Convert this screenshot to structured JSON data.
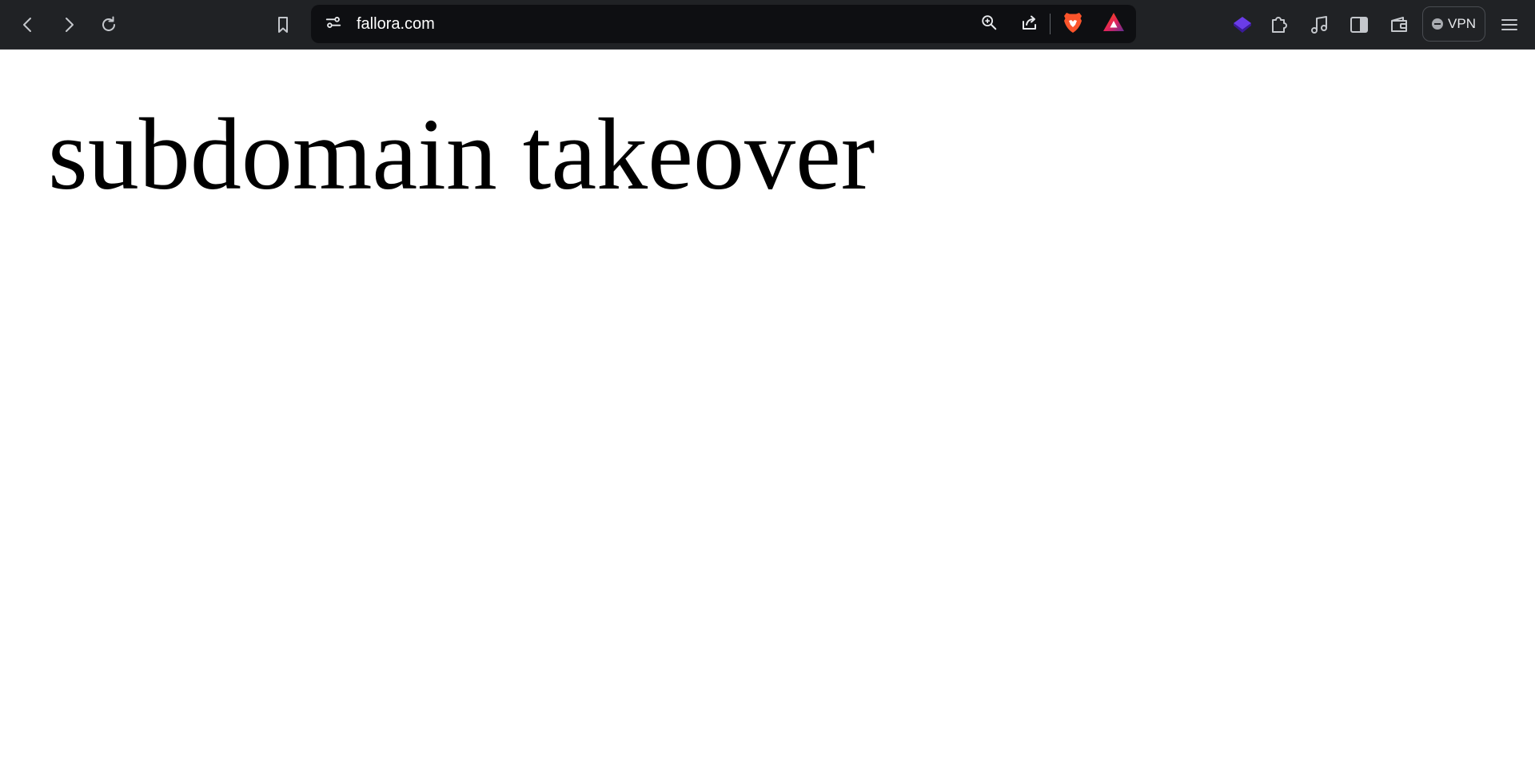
{
  "browser": {
    "url": "fallora.com",
    "nav_icons": [
      "back-icon",
      "forward-icon",
      "reload-icon",
      "bookmark-icon"
    ],
    "url_icons": [
      "site-settings-icon",
      "zoom-icon",
      "share-icon",
      "brave-shields-icon",
      "brave-rewards-icon"
    ],
    "toolbar_icons": [
      "wallet-extension-icon",
      "extensions-icon",
      "media-icon",
      "sidebar-icon",
      "wallet-icon",
      "menu-icon"
    ],
    "vpn_label": "VPN",
    "colors": {
      "toolbar_bg": "#202225",
      "urlbar_bg": "#0e0f12",
      "icon": "#c4c7cc",
      "brave_orange": "#fb542b",
      "extension_purple": "#4c1fb0"
    }
  },
  "page": {
    "heading": "subdomain takeover"
  }
}
